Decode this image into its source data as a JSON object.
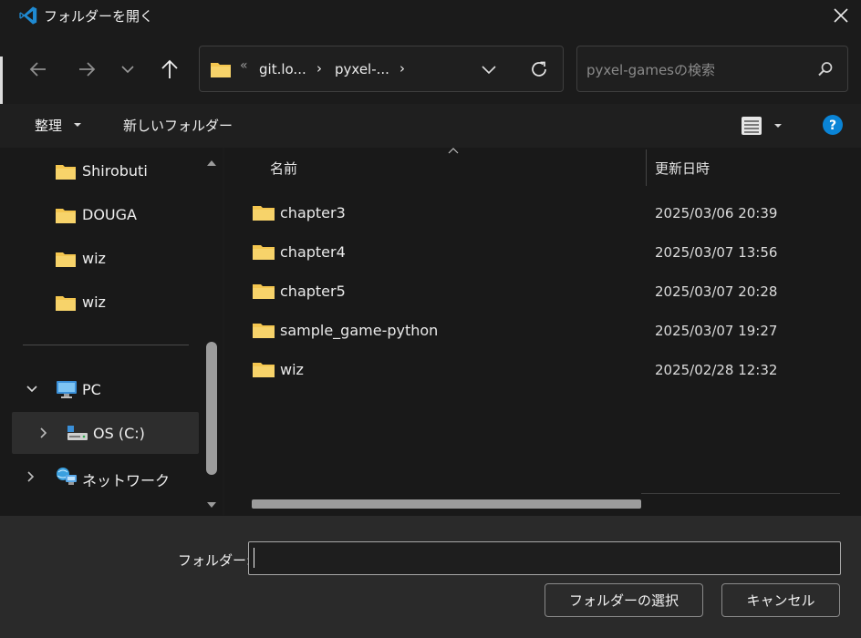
{
  "window": {
    "title": "フォルダーを開く"
  },
  "address": {
    "overflow": "«",
    "segments": [
      "git.lo...",
      "pyxel-..."
    ],
    "separator": "›"
  },
  "search": {
    "placeholder": "pyxel-gamesの検索"
  },
  "toolbar": {
    "organize": "整理",
    "new_folder": "新しいフォルダー"
  },
  "sidebar": {
    "items": [
      {
        "label": "Shirobuti"
      },
      {
        "label": "DOUGA"
      },
      {
        "label": "wiz"
      },
      {
        "label": "wiz"
      },
      {
        "label": "PC"
      },
      {
        "label": "OS (C:)"
      },
      {
        "label": "ネットワーク"
      }
    ]
  },
  "columns": {
    "name": "名前",
    "date": "更新日時"
  },
  "files": [
    {
      "name": "chapter3",
      "date": "2025/03/06 20:39"
    },
    {
      "name": "chapter4",
      "date": "2025/03/07 13:56"
    },
    {
      "name": "chapter5",
      "date": "2025/03/07 20:28"
    },
    {
      "name": "sample_game-python",
      "date": "2025/03/07 19:27"
    },
    {
      "name": "wiz",
      "date": "2025/02/28 12:32"
    }
  ],
  "footer": {
    "folder_label": "フォルダー:",
    "folder_value": "",
    "select_button": "フォルダーの選択",
    "cancel_button": "キャンセル"
  },
  "colors": {
    "accent": "#0a84d6",
    "folder": "#f4c64f"
  }
}
